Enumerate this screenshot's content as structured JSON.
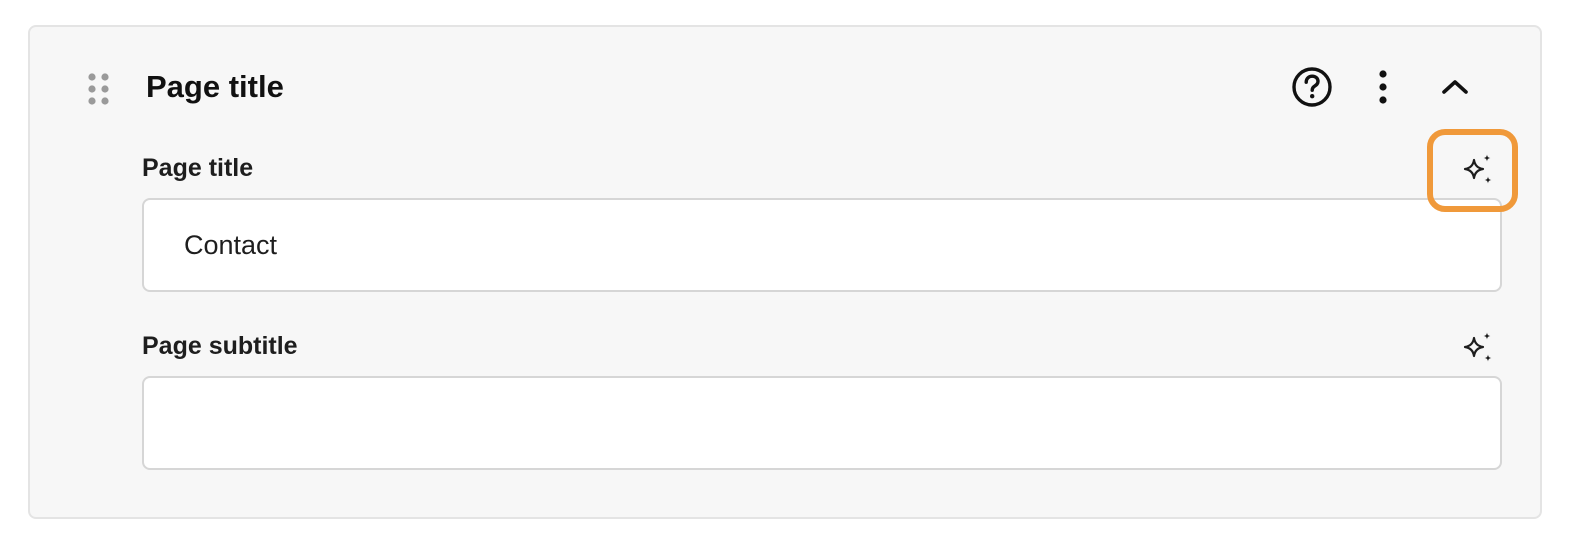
{
  "section": {
    "title": "Page title"
  },
  "header_icons": {
    "drag": "drag-handle-icon",
    "help": "help-circle-icon",
    "more": "more-vertical-icon",
    "collapse": "chevron-up-icon"
  },
  "fields": [
    {
      "label": "Page title",
      "value": "Contact",
      "placeholder": "",
      "ai_icon": "sparkles-icon"
    },
    {
      "label": "Page subtitle",
      "value": "",
      "placeholder": "",
      "ai_icon": "sparkles-icon"
    }
  ],
  "colors": {
    "highlight": "#f0993a",
    "panel_background": "#f7f7f7",
    "input_border": "#d6d6d6"
  }
}
